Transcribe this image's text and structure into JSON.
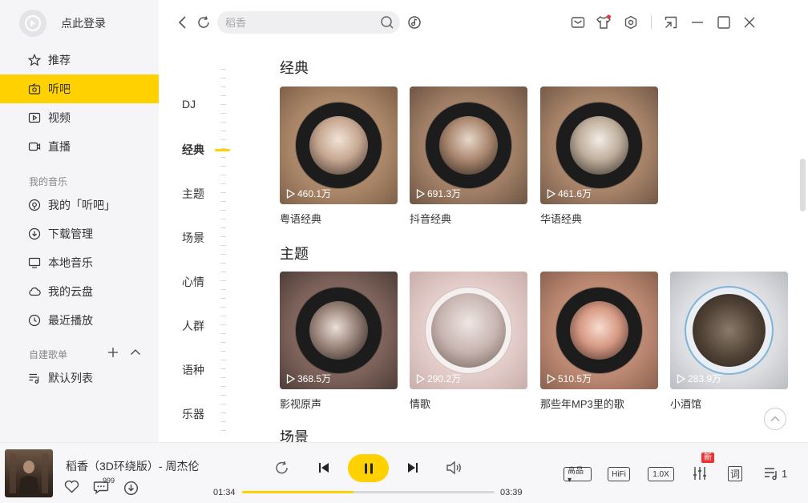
{
  "user": {
    "login_text": "点此登录"
  },
  "sidebar": {
    "items": [
      {
        "label": "推荐",
        "icon": "star-icon"
      },
      {
        "label": "听吧",
        "icon": "radio-icon"
      },
      {
        "label": "视频",
        "icon": "video-icon"
      },
      {
        "label": "直播",
        "icon": "live-icon"
      }
    ],
    "my_music_label": "我的音乐",
    "my_music": [
      {
        "label": "我的「听吧」",
        "icon": "listen-icon"
      },
      {
        "label": "下载管理",
        "icon": "download-icon"
      },
      {
        "label": "本地音乐",
        "icon": "monitor-icon"
      },
      {
        "label": "我的云盘",
        "icon": "cloud-icon"
      },
      {
        "label": "最近播放",
        "icon": "clock-icon"
      }
    ],
    "playlists_label": "自建歌单",
    "playlists": [
      {
        "label": "默认列表",
        "icon": "playlist-icon"
      }
    ]
  },
  "search": {
    "placeholder": "稻香"
  },
  "rail": {
    "items": [
      "DJ",
      "经典",
      "主题",
      "场景",
      "心情",
      "人群",
      "语种",
      "乐器"
    ],
    "active": "经典"
  },
  "sections": [
    {
      "title": "经典",
      "cards": [
        {
          "title": "粤语经典",
          "plays": "460.1万"
        },
        {
          "title": "抖音经典",
          "plays": "691.3万"
        },
        {
          "title": "华语经典",
          "plays": "461.6万"
        }
      ]
    },
    {
      "title": "主题",
      "cards": [
        {
          "title": "影视原声",
          "plays": "368.5万"
        },
        {
          "title": "情歌",
          "plays": "290.2万"
        },
        {
          "title": "那些年MP3里的歌",
          "plays": "510.5万"
        },
        {
          "title": "小酒馆",
          "plays": "283.9万"
        }
      ]
    },
    {
      "title": "场景",
      "cards": []
    }
  ],
  "player": {
    "song_title": "稻香（3D环绕版）- 周杰伦",
    "comment_count": "999",
    "current_time": "01:34",
    "total_time": "03:39",
    "progress_fraction": 0.44,
    "quality_label": "高品▾",
    "hifi_label": "HiFi",
    "speed_label": "1.0X",
    "new_badge": "新",
    "lyrics_label": "词",
    "queue_count": "1"
  },
  "colors": {
    "accent": "#ffd100",
    "sidebar_bg": "#f5f5f7"
  }
}
